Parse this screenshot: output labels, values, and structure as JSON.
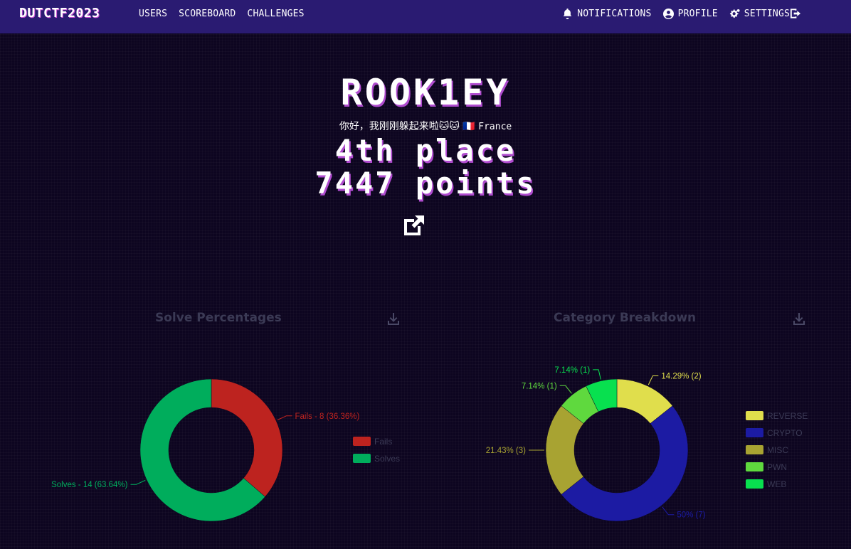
{
  "nav": {
    "brand": "DUTCTF2023",
    "left": [
      {
        "label": "USERS",
        "name": "nav-users"
      },
      {
        "label": "SCOREBOARD",
        "name": "nav-scoreboard"
      },
      {
        "label": "CHALLENGES",
        "name": "nav-challenges"
      }
    ],
    "right": [
      {
        "label": "NOTIFICATIONS",
        "icon": "bell-icon"
      },
      {
        "label": "PROFILE",
        "icon": "user-circle-icon"
      },
      {
        "label": "SETTINGS",
        "icon": "gears-icon"
      }
    ],
    "logout_icon": "sign-out-icon"
  },
  "profile": {
    "username": "ROOK1EY",
    "bio": "你好，我刚刚躲起来啦🐱🐱",
    "flag": "🇫🇷",
    "country": "France",
    "place": "4th place",
    "points": "7447 points",
    "link_icon": "external-link-icon"
  },
  "colors": {
    "navbar": "#2a1b72",
    "background": "#0d0520",
    "accent_shadow": "#b04ccf"
  },
  "chart_data": [
    {
      "type": "pie",
      "title": "Solve Percentages",
      "download_icon": "download-icon",
      "legend_position": "right",
      "slices": [
        {
          "name": "Fails",
          "value": 8,
          "percent": 36.36,
          "label": "Fails - 8 (36.36%)",
          "color": "#bd231f"
        },
        {
          "name": "Solves",
          "value": 14,
          "percent": 63.64,
          "label": "Solves - 14 (63.64%)",
          "color": "#00ad5c"
        }
      ]
    },
    {
      "type": "pie",
      "title": "Category Breakdown",
      "download_icon": "download-icon",
      "legend_position": "right",
      "slices": [
        {
          "name": "REVERSE",
          "value": 2,
          "percent": 14.29,
          "label": "14.29% (2)",
          "color": "#e0de4c"
        },
        {
          "name": "CRYPTO",
          "value": 7,
          "percent": 50,
          "label": "50% (7)",
          "color": "#1c1ba3"
        },
        {
          "name": "MISC",
          "value": 3,
          "percent": 21.43,
          "label": "21.43% (3)",
          "color": "#a8a332"
        },
        {
          "name": "PWN",
          "value": 1,
          "percent": 7.14,
          "label": "7.14% (1)",
          "color": "#5fd93e"
        },
        {
          "name": "WEB",
          "value": 1,
          "percent": 7.14,
          "label": "7.14% (1)",
          "color": "#08e04f"
        }
      ]
    }
  ]
}
